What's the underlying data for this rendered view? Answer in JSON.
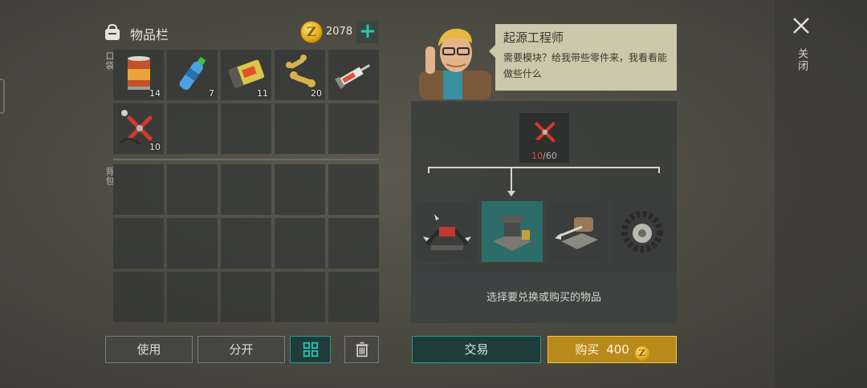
{
  "inventory": {
    "title": "物品栏",
    "coins": "2078",
    "pocket_label": "口袋",
    "backpack_label": "背包",
    "pocket_items": [
      {
        "icon": "canned-food-icon",
        "qty": "14"
      },
      {
        "icon": "water-bottle-icon",
        "qty": "7"
      },
      {
        "icon": "battery-icon",
        "qty": "11"
      },
      {
        "icon": "dog-bone-icon",
        "qty": "20"
      },
      {
        "icon": "syringe-icon",
        "qty": ""
      },
      {
        "icon": "pliers-parts-icon",
        "qty": "10"
      },
      {
        "icon": "",
        "qty": ""
      },
      {
        "icon": "",
        "qty": ""
      },
      {
        "icon": "",
        "qty": ""
      },
      {
        "icon": "",
        "qty": ""
      }
    ],
    "backpack_slots": 15,
    "buttons": {
      "use": "使用",
      "split": "分开"
    }
  },
  "npc": {
    "name": "起源工程师",
    "dialogue": "需要模块？给我带些零件来，我看看能做些什么"
  },
  "craft": {
    "required_item": {
      "icon": "pliers-parts-icon",
      "have": "10",
      "need": "/60"
    },
    "options": [
      {
        "icon": "spiked-cage-module-icon",
        "selected": false
      },
      {
        "icon": "vise-workbench-icon",
        "selected": true
      },
      {
        "icon": "crossbow-turret-icon",
        "selected": false
      },
      {
        "icon": "gear-saw-icon",
        "selected": false
      }
    ],
    "hint": "选择要兑换或购买的物品",
    "trade_label": "交易",
    "buy_label": "购买",
    "buy_price": "400"
  },
  "close_label": "关闭",
  "colors": {
    "accent": "#22c7b0",
    "gold": "#b88a1c",
    "shortage": "#e34c3d"
  }
}
